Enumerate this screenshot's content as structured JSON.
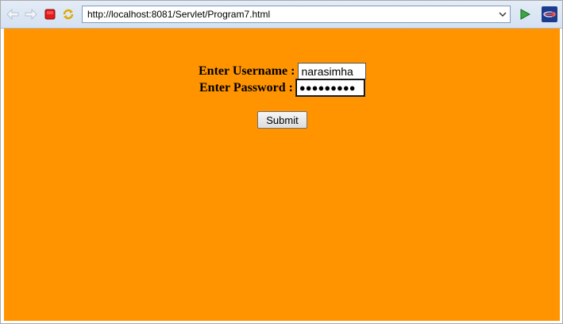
{
  "browser": {
    "address": "http://localhost:8081/Servlet/Program7.html",
    "icons": {
      "back": "back-arrow-icon",
      "forward": "forward-arrow-icon",
      "stop": "stop-icon",
      "refresh": "refresh-icon",
      "dropdown": "chevron-down-icon",
      "go": "go-play-icon",
      "logo": "browser-logo-icon"
    }
  },
  "page": {
    "background_color": "#ff9400",
    "username_label": "Enter Username :",
    "username_value": "narasimha",
    "password_label": "Enter Password :",
    "password_masked": "●●●●●●●●●",
    "submit_label": "Submit"
  }
}
